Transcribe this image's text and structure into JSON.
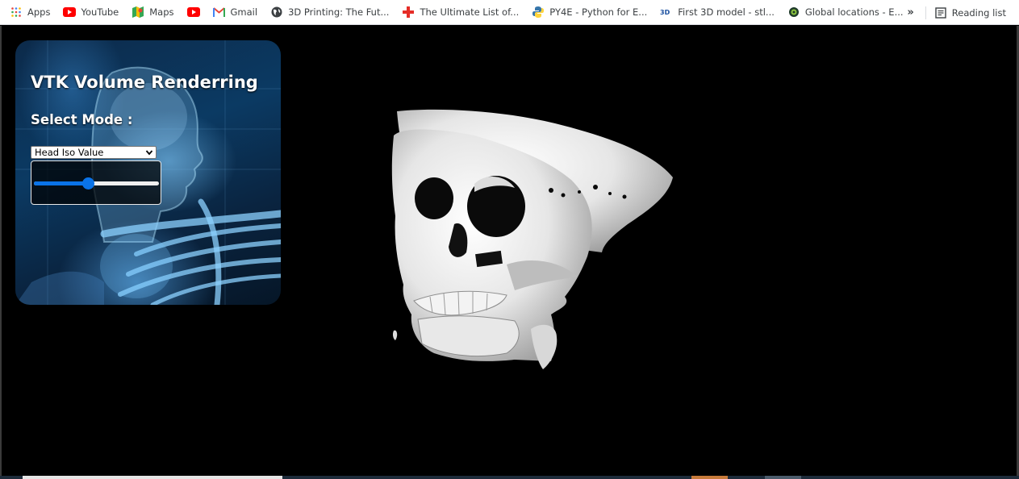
{
  "bookmarks": [
    {
      "label": "Apps",
      "icon": "apps-grid-icon"
    },
    {
      "label": "YouTube",
      "icon": "youtube-icon"
    },
    {
      "label": "Maps",
      "icon": "maps-icon"
    },
    {
      "label": "",
      "icon": "youtube-icon"
    },
    {
      "label": "Gmail",
      "icon": "gmail-icon"
    },
    {
      "label": "3D Printing: The Fut...",
      "icon": "globe-icon"
    },
    {
      "label": "The Ultimate List of...",
      "icon": "red-cross-icon"
    },
    {
      "label": "PY4E - Python for E...",
      "icon": "python-icon"
    },
    {
      "label": "First 3D model - stl...",
      "icon": "3d-icon"
    },
    {
      "label": "Global locations - E...",
      "icon": "location-icon"
    }
  ],
  "bookmarks_overflow": "»",
  "reading_list": {
    "label": "Reading list",
    "icon": "reading-list-icon"
  },
  "colors": {
    "accent": "#0a73e8",
    "background": "#000000",
    "panel": "#0b3a63"
  },
  "panel": {
    "title": "VTK Volume Renderring",
    "select_label": "Select Mode :",
    "mode_select": {
      "value": "Head Iso Value",
      "icon": "chevron-down-icon"
    },
    "slider": {
      "value_fraction": 0.43
    }
  }
}
